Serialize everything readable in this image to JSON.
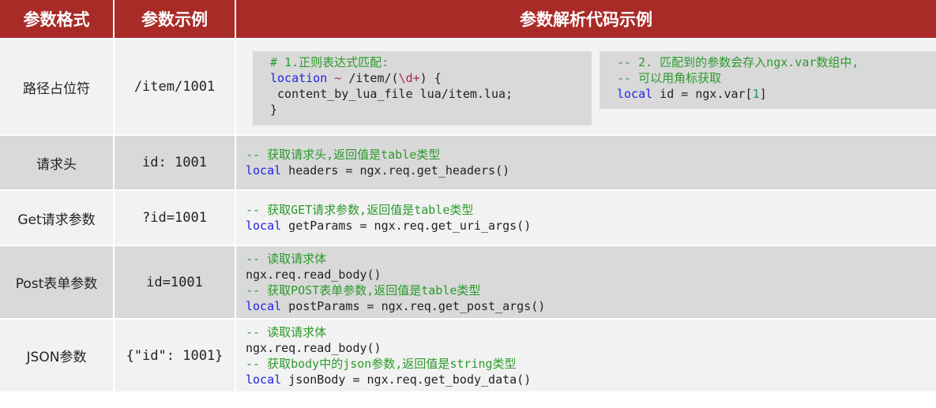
{
  "header": {
    "col1": "参数格式",
    "col2": "参数示例",
    "col3": "参数解析代码示例"
  },
  "colors": {
    "header_bg": "#a92b28",
    "row_light": "#f2f2f2",
    "row_dark": "#d9d9d9",
    "comment": "#2b9a2b",
    "keyword": "#2323e6"
  },
  "rows": [
    {
      "format": "路径占位符",
      "example": "/item/1001",
      "code_block_1": {
        "comment": "# 1.正则表达式匹配:",
        "kw": "location",
        "tilde": " ~ ",
        "path": "/item/(",
        "regex": "\\d+",
        "path_end": ") {",
        "line3": " content_by_lua_file lua/item.lua;",
        "line4": "}"
      },
      "code_block_2": {
        "comment1": "-- 2. 匹配到的参数会存入ngx.var数组中,",
        "comment2": "-- 可以用角标获取",
        "kw": "local",
        "rest": " id = ngx.var[",
        "index": "1",
        "close": "]"
      }
    },
    {
      "format": "请求头",
      "example": "id: 1001",
      "code": {
        "comment": "-- 获取请求头,返回值是table类型",
        "kw": "local",
        "rest": " headers = ngx.req.get_headers()"
      }
    },
    {
      "format": "Get请求参数",
      "example": "?id=1001",
      "code": {
        "comment": "-- 获取GET请求参数,返回值是table类型",
        "kw": "local",
        "rest": " getParams = ngx.req.get_uri_args()"
      }
    },
    {
      "format": "Post表单参数",
      "example": "id=1001",
      "code": {
        "comment1": "-- 读取请求体",
        "line2": "ngx.req.read_body()",
        "comment2": "-- 获取POST表单参数,返回值是table类型",
        "kw": "local",
        "rest": " postParams = ngx.req.get_post_args()"
      }
    },
    {
      "format": "JSON参数",
      "example": "{\"id\": 1001}",
      "code": {
        "comment1": "-- 读取请求体",
        "line2": "ngx.req.read_body()",
        "comment2": "-- 获取body中的json参数,返回值是string类型",
        "kw": "local",
        "rest": " jsonBody = ngx.req.get_body_data()"
      }
    }
  ]
}
